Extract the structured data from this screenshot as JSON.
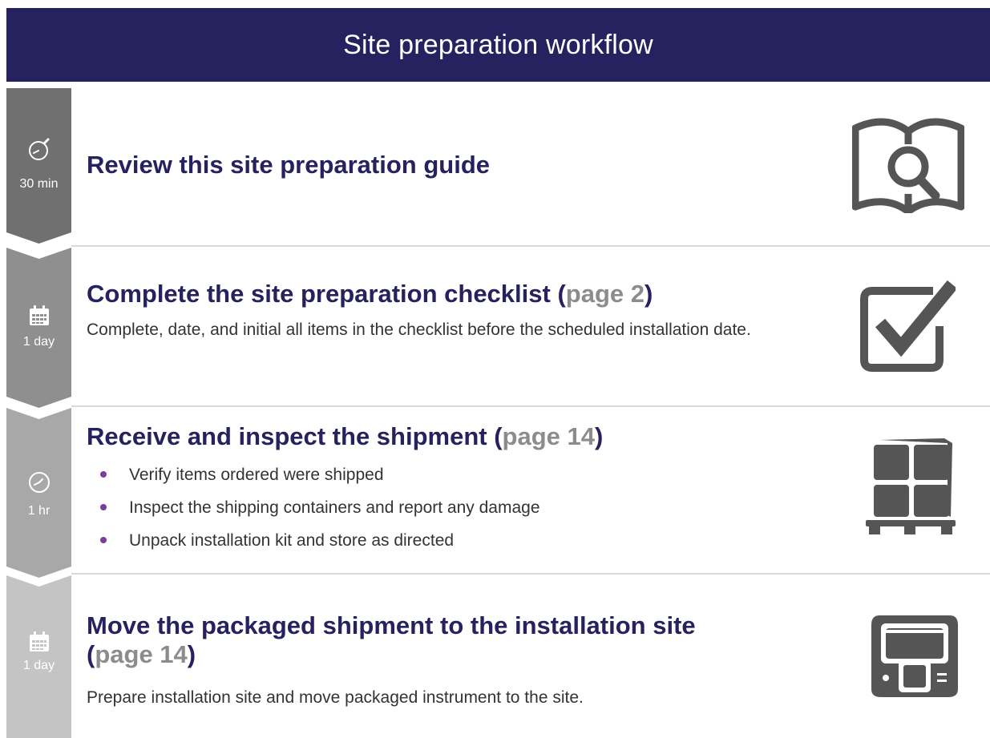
{
  "header": {
    "title": "Site preparation workflow"
  },
  "colors": {
    "header_bg": "#26215f",
    "title_text": "#26215f",
    "page_ref": "#8c8c8c",
    "bullet": "#7a3e9d",
    "icon_gray": "#555555",
    "step_gray_1": "#707070",
    "step_gray_2": "#8f8f8f",
    "step_gray_3": "#a8a8a8",
    "step_gray_4": "#c4c4c4"
  },
  "steps": [
    {
      "time_icon": "stopwatch-icon",
      "duration": "30 min",
      "title": "Review this site preparation guide",
      "right_icon": "book-magnifier-icon"
    },
    {
      "time_icon": "calendar-icon",
      "duration": "1 day",
      "title": "Complete the site preparation checklist (",
      "page_ref": "page 2",
      "title_close": ")",
      "description": "Complete, date, and initial all items in the checklist before the scheduled installation date.",
      "right_icon": "checkbox-checked-icon"
    },
    {
      "time_icon": "clock-icon",
      "duration": "1 hr",
      "title": "Receive and inspect the shipment (",
      "page_ref": "page 14",
      "title_close": ")",
      "bullets": [
        "Verify items ordered were shipped",
        "Inspect the shipping containers and report any damage",
        "Unpack installation kit and store as directed"
      ],
      "right_icon": "pallet-boxes-icon"
    },
    {
      "time_icon": "calendar-icon",
      "duration": "1 day",
      "title": "Move the packaged shipment to the installation site",
      "title_line2_open": "(",
      "page_ref": "page 14",
      "title_close": ")",
      "description": "Prepare installation site and move packaged instrument to the site.",
      "right_icon": "instrument-icon"
    }
  ]
}
